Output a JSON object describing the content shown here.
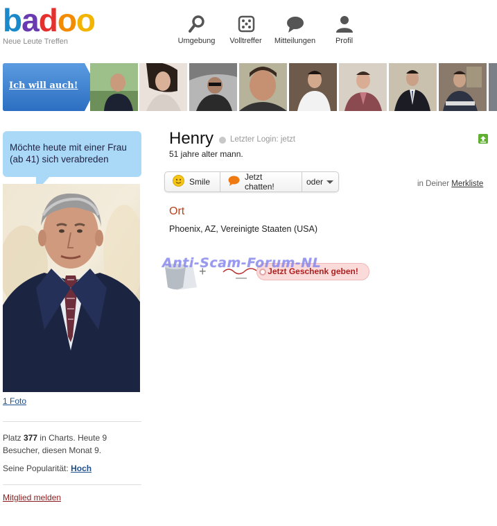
{
  "header": {
    "logo": "badoo",
    "tagline": "Neue Leute Treffen",
    "nav": [
      {
        "label": "Umgebung",
        "icon": "search-icon"
      },
      {
        "label": "Volltreffer",
        "icon": "dice-icon"
      },
      {
        "label": "Mitteilungen",
        "icon": "speech-bubble-icon"
      },
      {
        "label": "Profil",
        "icon": "user-icon"
      }
    ]
  },
  "strip": {
    "cta_label": "Ich will auch!"
  },
  "sidebar": {
    "status_message": "Möchte heute mit einer Frau (ab 41) sich verabreden",
    "photo_count": "1 Foto",
    "charts": {
      "prefix": "Platz",
      "rank": "377",
      "suffix": "in Charts. Heute 9 Besucher, diesen Monat 9."
    },
    "popularity_label": "Seine Popularität:",
    "popularity_value": "Hoch",
    "report_label": "Mitglied melden"
  },
  "profile": {
    "name": "Henry",
    "login_status": "Letzter Login: jetzt",
    "age_text": "51 jahre alter mann.",
    "actions": {
      "smile": "Smile",
      "chat": "Jetzt chatten!",
      "more": "oder"
    },
    "favorites_prefix": "in Deiner",
    "favorites_link": "Merkliste",
    "location_heading": "Ort",
    "location": "Phoenix, AZ, Vereinigte Staaten (USA)",
    "gift_button": "Jetzt Geschenk geben!"
  },
  "watermark": "Anti-Scam-Forum-NL",
  "colors": {
    "bubble": "#a9d9f7",
    "cta_blue": "#3a7ed0",
    "location_heading": "#b5421c",
    "gift_button": "#fbdada"
  }
}
